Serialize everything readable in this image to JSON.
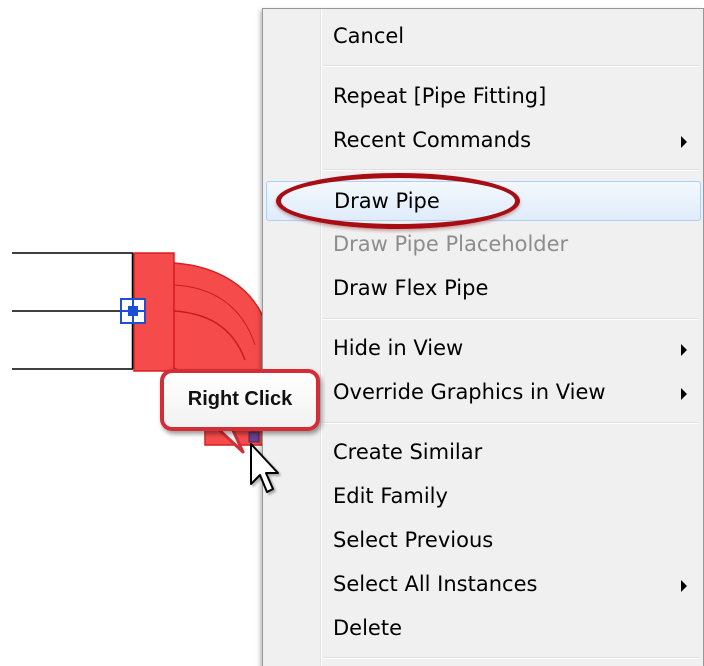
{
  "menu": {
    "items": [
      {
        "label": "Cancel",
        "disabled": false,
        "submenu": false
      },
      {
        "label": "Repeat [Pipe Fitting]",
        "disabled": false,
        "submenu": false
      },
      {
        "label": "Recent Commands",
        "disabled": false,
        "submenu": true
      },
      {
        "label": "Draw Pipe",
        "disabled": false,
        "submenu": false,
        "highlighted": true
      },
      {
        "label": "Draw Pipe Placeholder",
        "disabled": true,
        "submenu": false
      },
      {
        "label": "Draw Flex Pipe",
        "disabled": false,
        "submenu": false
      },
      {
        "label": "Hide in View",
        "disabled": false,
        "submenu": true
      },
      {
        "label": "Override Graphics in View",
        "disabled": false,
        "submenu": true
      },
      {
        "label": "Create Similar",
        "disabled": false,
        "submenu": false
      },
      {
        "label": "Edit Family",
        "disabled": false,
        "submenu": false
      },
      {
        "label": "Select Previous",
        "disabled": false,
        "submenu": false
      },
      {
        "label": "Select All Instances",
        "disabled": false,
        "submenu": true
      },
      {
        "label": "Delete",
        "disabled": false,
        "submenu": false
      }
    ]
  },
  "callout": {
    "label": "Right Click"
  },
  "colors": {
    "pipe_fitting_fill": "#f64b4b",
    "pipe_fitting_stroke": "#d62020",
    "ellipse": "#a90d14",
    "callout_border": "#d32d36",
    "grip": "#1a4fd6",
    "menu_bg": "#f0f0f0",
    "menu_highlight_border": "#aecff7",
    "disabled_text": "#8d8d8d"
  },
  "icons": {
    "grip": "blue-square-grip-icon",
    "cursor": "arrow-cursor-icon",
    "submenu": "triangle-right-icon"
  }
}
